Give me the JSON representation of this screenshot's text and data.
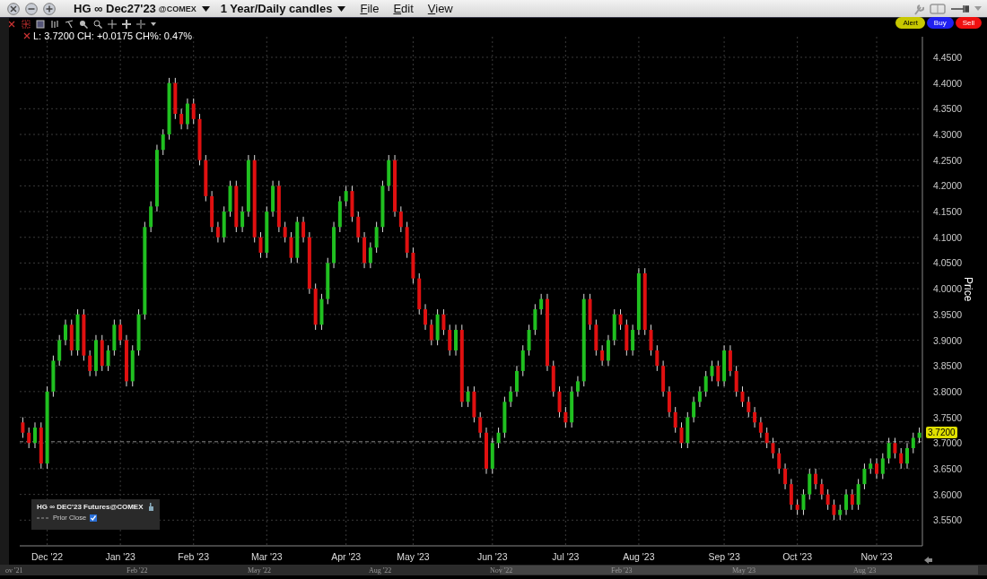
{
  "window": {
    "title": "HG ∞ Dec27'23",
    "exchange": "@COMEX",
    "period": "1 Year/Daily candles",
    "menus": [
      "File",
      "Edit",
      "View"
    ]
  },
  "order_buttons": [
    {
      "label": "Alert",
      "kind": "alert"
    },
    {
      "label": "Buy",
      "kind": "buy"
    },
    {
      "label": "Sell",
      "kind": "sell"
    }
  ],
  "quote": "L: 3.7200 CH: +0.0175 CH%: 0.47%",
  "legend": {
    "title": "HG ∞ DEC'23 Futures@COMEX",
    "items": [
      {
        "label": "Prior Close",
        "checked": true
      }
    ]
  },
  "last_price_tag": "3.7200",
  "chart": {
    "chart_data": {
      "type": "candlestick",
      "ylabel": "Price",
      "grid": true,
      "ylim": [
        3.5,
        4.49
      ],
      "categories": [
        null,
        null,
        null,
        null,
        "Dec '22",
        null,
        null,
        null,
        null,
        null,
        null,
        null,
        null,
        null,
        null,
        null,
        "Jan '23",
        null,
        null,
        null,
        null,
        null,
        null,
        null,
        null,
        null,
        null,
        null,
        "Feb '23",
        null,
        null,
        null,
        null,
        null,
        null,
        null,
        null,
        null,
        null,
        null,
        "Mar '23",
        null,
        null,
        null,
        null,
        null,
        null,
        null,
        null,
        null,
        null,
        null,
        null,
        "Apr '23",
        null,
        null,
        null,
        null,
        null,
        null,
        null,
        null,
        null,
        null,
        "May '23",
        null,
        null,
        null,
        null,
        null,
        null,
        null,
        null,
        null,
        null,
        null,
        null,
        "Jun '23",
        null,
        null,
        null,
        null,
        null,
        null,
        null,
        null,
        null,
        null,
        null,
        "Jul '23",
        null,
        null,
        null,
        null,
        null,
        null,
        null,
        null,
        null,
        null,
        null,
        "Aug '23",
        null,
        null,
        null,
        null,
        null,
        null,
        null,
        null,
        null,
        null,
        null,
        null,
        null,
        "Sep '23",
        null,
        null,
        null,
        null,
        null,
        null,
        null,
        null,
        null,
        null,
        null,
        "Oct '23",
        null,
        null,
        null,
        null,
        null,
        null,
        null,
        null,
        null,
        null,
        null,
        null,
        "Nov '23",
        null,
        null,
        null,
        null,
        null,
        null,
        null
      ],
      "ohlc": [
        [
          3.74,
          3.75,
          3.71,
          3.72
        ],
        [
          3.72,
          3.73,
          3.69,
          3.7
        ],
        [
          3.7,
          3.74,
          3.69,
          3.73
        ],
        [
          3.73,
          3.74,
          3.65,
          3.66
        ],
        [
          3.66,
          3.81,
          3.65,
          3.8
        ],
        [
          3.8,
          3.87,
          3.79,
          3.86
        ],
        [
          3.86,
          3.91,
          3.85,
          3.9
        ],
        [
          3.9,
          3.94,
          3.89,
          3.93
        ],
        [
          3.93,
          3.94,
          3.87,
          3.88
        ],
        [
          3.88,
          3.96,
          3.87,
          3.95
        ],
        [
          3.95,
          3.96,
          3.86,
          3.87
        ],
        [
          3.87,
          3.88,
          3.83,
          3.84
        ],
        [
          3.84,
          3.91,
          3.83,
          3.9
        ],
        [
          3.9,
          3.91,
          3.84,
          3.85
        ],
        [
          3.85,
          3.89,
          3.84,
          3.88
        ],
        [
          3.88,
          3.94,
          3.87,
          3.93
        ],
        [
          3.93,
          3.94,
          3.89,
          3.9
        ],
        [
          3.9,
          3.91,
          3.81,
          3.82
        ],
        [
          3.82,
          3.89,
          3.81,
          3.88
        ],
        [
          3.88,
          3.96,
          3.87,
          3.95
        ],
        [
          3.95,
          4.13,
          3.94,
          4.12
        ],
        [
          4.12,
          4.17,
          4.11,
          4.16
        ],
        [
          4.16,
          4.28,
          4.15,
          4.27
        ],
        [
          4.27,
          4.31,
          4.26,
          4.3
        ],
        [
          4.3,
          4.41,
          4.29,
          4.4
        ],
        [
          4.4,
          4.41,
          4.33,
          4.34
        ],
        [
          4.34,
          4.35,
          4.31,
          4.32
        ],
        [
          4.32,
          4.37,
          4.31,
          4.36
        ],
        [
          4.36,
          4.37,
          4.32,
          4.33
        ],
        [
          4.33,
          4.34,
          4.24,
          4.25
        ],
        [
          4.25,
          4.26,
          4.17,
          4.18
        ],
        [
          4.18,
          4.19,
          4.11,
          4.12
        ],
        [
          4.12,
          4.13,
          4.09,
          4.1
        ],
        [
          4.1,
          4.16,
          4.09,
          4.15
        ],
        [
          4.15,
          4.21,
          4.14,
          4.2
        ],
        [
          4.2,
          4.21,
          4.11,
          4.12
        ],
        [
          4.12,
          4.16,
          4.11,
          4.15
        ],
        [
          4.15,
          4.26,
          4.14,
          4.25
        ],
        [
          4.25,
          4.26,
          4.09,
          4.1
        ],
        [
          4.1,
          4.11,
          4.06,
          4.07
        ],
        [
          4.07,
          4.16,
          4.06,
          4.15
        ],
        [
          4.15,
          4.21,
          4.14,
          4.2
        ],
        [
          4.2,
          4.21,
          4.11,
          4.12
        ],
        [
          4.12,
          4.13,
          4.09,
          4.1
        ],
        [
          4.1,
          4.11,
          4.05,
          4.06
        ],
        [
          4.06,
          4.14,
          4.05,
          4.13
        ],
        [
          4.13,
          4.14,
          4.09,
          4.1
        ],
        [
          4.1,
          4.11,
          3.99,
          4.0
        ],
        [
          4.0,
          4.01,
          3.92,
          3.93
        ],
        [
          3.93,
          3.99,
          3.92,
          3.98
        ],
        [
          3.98,
          4.06,
          3.97,
          4.05
        ],
        [
          4.05,
          4.13,
          4.04,
          4.12
        ],
        [
          4.12,
          4.18,
          4.11,
          4.17
        ],
        [
          4.17,
          4.2,
          4.16,
          4.19
        ],
        [
          4.19,
          4.2,
          4.13,
          4.14
        ],
        [
          4.14,
          4.15,
          4.09,
          4.1
        ],
        [
          4.1,
          4.11,
          4.04,
          4.05
        ],
        [
          4.05,
          4.09,
          4.04,
          4.08
        ],
        [
          4.08,
          4.13,
          4.07,
          4.12
        ],
        [
          4.12,
          4.21,
          4.11,
          4.2
        ],
        [
          4.2,
          4.26,
          4.19,
          4.25
        ],
        [
          4.25,
          4.26,
          4.14,
          4.15
        ],
        [
          4.15,
          4.16,
          4.11,
          4.12
        ],
        [
          4.12,
          4.13,
          4.06,
          4.07
        ],
        [
          4.07,
          4.08,
          4.01,
          4.02
        ],
        [
          4.02,
          4.03,
          3.95,
          3.96
        ],
        [
          3.96,
          3.97,
          3.92,
          3.93
        ],
        [
          3.93,
          3.94,
          3.89,
          3.9
        ],
        [
          3.9,
          3.96,
          3.89,
          3.95
        ],
        [
          3.95,
          3.96,
          3.91,
          3.92
        ],
        [
          3.92,
          3.93,
          3.87,
          3.88
        ],
        [
          3.88,
          3.93,
          3.87,
          3.92
        ],
        [
          3.92,
          3.93,
          3.77,
          3.78
        ],
        [
          3.78,
          3.81,
          3.77,
          3.8
        ],
        [
          3.8,
          3.81,
          3.74,
          3.75
        ],
        [
          3.75,
          3.76,
          3.71,
          3.72
        ],
        [
          3.72,
          3.73,
          3.64,
          3.65
        ],
        [
          3.65,
          3.71,
          3.64,
          3.7
        ],
        [
          3.7,
          3.73,
          3.69,
          3.72
        ],
        [
          3.72,
          3.79,
          3.71,
          3.78
        ],
        [
          3.78,
          3.81,
          3.77,
          3.8
        ],
        [
          3.8,
          3.85,
          3.79,
          3.84
        ],
        [
          3.84,
          3.89,
          3.83,
          3.88
        ],
        [
          3.88,
          3.93,
          3.87,
          3.92
        ],
        [
          3.92,
          3.97,
          3.91,
          3.96
        ],
        [
          3.96,
          3.99,
          3.95,
          3.98
        ],
        [
          3.98,
          3.99,
          3.84,
          3.85
        ],
        [
          3.85,
          3.86,
          3.79,
          3.8
        ],
        [
          3.8,
          3.81,
          3.75,
          3.76
        ],
        [
          3.76,
          3.77,
          3.73,
          3.74
        ],
        [
          3.74,
          3.81,
          3.73,
          3.8
        ],
        [
          3.8,
          3.83,
          3.79,
          3.82
        ],
        [
          3.82,
          3.99,
          3.81,
          3.98
        ],
        [
          3.98,
          3.99,
          3.92,
          3.93
        ],
        [
          3.93,
          3.94,
          3.87,
          3.88
        ],
        [
          3.88,
          3.89,
          3.85,
          3.86
        ],
        [
          3.86,
          3.91,
          3.85,
          3.9
        ],
        [
          3.9,
          3.96,
          3.89,
          3.95
        ],
        [
          3.95,
          3.96,
          3.92,
          3.93
        ],
        [
          3.93,
          3.94,
          3.87,
          3.88
        ],
        [
          3.88,
          3.93,
          3.87,
          3.92
        ],
        [
          3.92,
          4.04,
          3.91,
          4.03
        ],
        [
          4.03,
          4.04,
          3.91,
          3.92
        ],
        [
          3.92,
          3.93,
          3.87,
          3.88
        ],
        [
          3.88,
          3.89,
          3.84,
          3.85
        ],
        [
          3.85,
          3.86,
          3.79,
          3.8
        ],
        [
          3.8,
          3.81,
          3.75,
          3.76
        ],
        [
          3.76,
          3.77,
          3.72,
          3.73
        ],
        [
          3.73,
          3.74,
          3.69,
          3.7
        ],
        [
          3.7,
          3.76,
          3.69,
          3.75
        ],
        [
          3.75,
          3.79,
          3.74,
          3.78
        ],
        [
          3.78,
          3.81,
          3.77,
          3.8
        ],
        [
          3.8,
          3.84,
          3.79,
          3.83
        ],
        [
          3.83,
          3.86,
          3.82,
          3.85
        ],
        [
          3.85,
          3.86,
          3.81,
          3.82
        ],
        [
          3.82,
          3.89,
          3.81,
          3.88
        ],
        [
          3.88,
          3.89,
          3.83,
          3.84
        ],
        [
          3.84,
          3.85,
          3.79,
          3.8
        ],
        [
          3.8,
          3.81,
          3.77,
          3.78
        ],
        [
          3.78,
          3.79,
          3.75,
          3.76
        ],
        [
          3.76,
          3.77,
          3.73,
          3.74
        ],
        [
          3.74,
          3.75,
          3.71,
          3.72
        ],
        [
          3.72,
          3.73,
          3.69,
          3.7
        ],
        [
          3.7,
          3.71,
          3.67,
          3.68
        ],
        [
          3.68,
          3.69,
          3.64,
          3.65
        ],
        [
          3.65,
          3.66,
          3.61,
          3.62
        ],
        [
          3.62,
          3.63,
          3.57,
          3.58
        ],
        [
          3.58,
          3.59,
          3.56,
          3.57
        ],
        [
          3.57,
          3.61,
          3.56,
          3.6
        ],
        [
          3.6,
          3.65,
          3.59,
          3.64
        ],
        [
          3.64,
          3.65,
          3.61,
          3.62
        ],
        [
          3.62,
          3.63,
          3.59,
          3.6
        ],
        [
          3.6,
          3.61,
          3.57,
          3.58
        ],
        [
          3.58,
          3.59,
          3.55,
          3.56
        ],
        [
          3.56,
          3.58,
          3.55,
          3.57
        ],
        [
          3.57,
          3.61,
          3.56,
          3.6
        ],
        [
          3.6,
          3.61,
          3.57,
          3.58
        ],
        [
          3.58,
          3.63,
          3.57,
          3.62
        ],
        [
          3.62,
          3.66,
          3.61,
          3.65
        ],
        [
          3.65,
          3.67,
          3.64,
          3.66
        ],
        [
          3.66,
          3.67,
          3.63,
          3.64
        ],
        [
          3.64,
          3.68,
          3.63,
          3.67
        ],
        [
          3.67,
          3.71,
          3.66,
          3.7
        ],
        [
          3.7,
          3.71,
          3.67,
          3.68
        ],
        [
          3.68,
          3.69,
          3.65,
          3.66
        ],
        [
          3.66,
          3.7,
          3.65,
          3.69
        ],
        [
          3.69,
          3.72,
          3.68,
          3.71
        ],
        [
          3.71,
          3.73,
          3.7,
          3.72
        ]
      ],
      "yticks": [
        {
          "value": 3.55,
          "label": "3.5500"
        },
        {
          "value": 3.6,
          "label": "3.6000"
        },
        {
          "value": 3.65,
          "label": "3.6500"
        },
        {
          "value": 3.7,
          "label": "3.7000"
        },
        {
          "value": 3.75,
          "label": "3.7500"
        },
        {
          "value": 3.8,
          "label": "3.8000"
        },
        {
          "value": 3.85,
          "label": "3.8500"
        },
        {
          "value": 3.9,
          "label": "3.9000"
        },
        {
          "value": 3.95,
          "label": "3.9500"
        },
        {
          "value": 4.0,
          "label": "4.0000"
        },
        {
          "value": 4.05,
          "label": "4.0500"
        },
        {
          "value": 4.1,
          "label": "4.1000"
        },
        {
          "value": 4.15,
          "label": "4.1500"
        },
        {
          "value": 4.2,
          "label": "4.2000"
        },
        {
          "value": 4.25,
          "label": "4.2500"
        },
        {
          "value": 4.3,
          "label": "4.3000"
        },
        {
          "value": 4.35,
          "label": "4.3500"
        },
        {
          "value": 4.4,
          "label": "4.4000"
        },
        {
          "value": 4.45,
          "label": "4.4500"
        }
      ],
      "ref_lines": [
        {
          "axis": "y",
          "value": 3.7025
        }
      ]
    }
  },
  "navigator": {
    "labels": [
      "ov '21",
      "Feb '22",
      "May '22",
      "Aug '22",
      "Nov '22",
      "Feb '23",
      "May '23",
      "Aug '23"
    ]
  }
}
